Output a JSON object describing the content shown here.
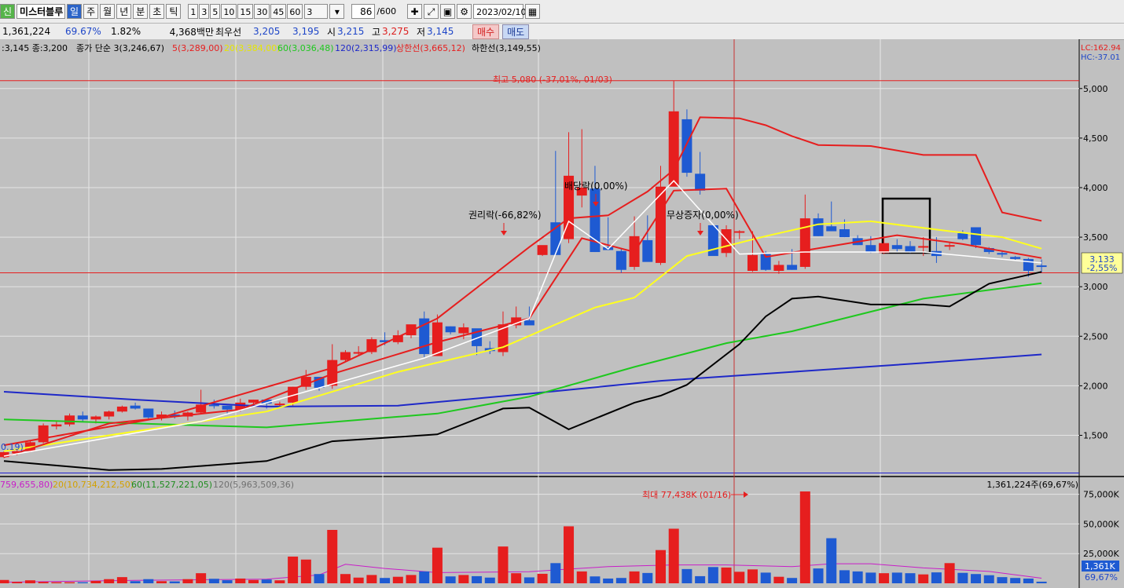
{
  "toolbar": {
    "badge": "신",
    "stock_name": "미스터블루",
    "periods": [
      {
        "label": "일",
        "selected": true
      },
      {
        "label": "주",
        "selected": false
      },
      {
        "label": "월",
        "selected": false
      },
      {
        "label": "년",
        "selected": false
      },
      {
        "label": "분",
        "selected": false
      },
      {
        "label": "초",
        "selected": false
      },
      {
        "label": "틱",
        "selected": false
      }
    ],
    "intervals": [
      "1",
      "3",
      "5",
      "10",
      "15",
      "30",
      "45",
      "60"
    ],
    "interval_select": "3",
    "count_value": "86",
    "count_total": "/600",
    "date": "2023/02/10",
    "icons": [
      "crosshair-icon",
      "trend-icon",
      "save-icon",
      "gear-icon"
    ]
  },
  "info": {
    "volume": "1,361,224",
    "vol_ratio": "69.67%",
    "turnover": "1.82%",
    "amount": "4,368백만",
    "best_ask_label": "최우선",
    "best_ask": "3,205",
    "best_bid": "3,195",
    "open_label": "시",
    "open": "3,215",
    "high_label": "고",
    "high": "3,275",
    "low_label": "저",
    "low": "3,145",
    "buy": "매수",
    "sell": "매도"
  },
  "price_header": [
    {
      "text": ":3,145 종:3,200",
      "color": "#000000"
    },
    {
      "text": "종가 단순 3(3,246,67)",
      "color": "#000000"
    },
    {
      "text": "5(3,289,00)",
      "color": "#e61e1e"
    },
    {
      "text": "20(3,384,00)",
      "color": "#e6e600"
    },
    {
      "text": "60(3,036,48)",
      "color": "#1ec81e"
    },
    {
      "text": "120(2,315,99)",
      "color": "#1e28c8"
    },
    {
      "text": "상한선(3,665,12)",
      "color": "#e61e1e"
    },
    {
      "text": "하한선(3,149,55)",
      "color": "#000000"
    }
  ],
  "volume_header": [
    {
      "text": "759,655,80)",
      "color": "#c81ec8"
    },
    {
      "text": "20(10,734,212,50)",
      "color": "#d2a000"
    },
    {
      "text": "60(11,527,221,05)",
      "color": "#1e8c1e"
    },
    {
      "text": "120(5,963,509,36)",
      "color": "#707070"
    }
  ],
  "volume_right_label": "1,361,224주(69,67%)",
  "lc_label": "LC:162.94",
  "hc_label": "HC:-37.01",
  "left_edge_label": "0.19)",
  "annotations": {
    "max_price": "최고 5,080 (-37,01%, 01/03)",
    "rights": "권리락(-66,82%)",
    "dividend": "배당락(0,00%)",
    "bonus": "무상증자(0,00%)",
    "max_volume": "최대 77,438K (01/16)"
  },
  "current_price": "3,133",
  "current_change": "-2,55%",
  "current_vol": "1,361K",
  "current_vol_ratio": "69,67%",
  "chart_data": {
    "type": "candlestick",
    "price_axis": {
      "ticks": [
        "5,000",
        "4,500",
        "4,000",
        "3,500",
        "3,000",
        "2,500",
        "2,000",
        "1,500"
      ],
      "ylim": [
        1100,
        5450
      ]
    },
    "volume_axis": {
      "ticks": [
        "75,000K",
        "50,000K",
        "25,000K"
      ],
      "ylim_k": [
        0,
        88000
      ]
    },
    "candles": [
      [
        1280,
        1340,
        1270,
        1330,
        2800
      ],
      [
        1320,
        1360,
        1300,
        1340,
        1200
      ],
      [
        1340,
        1450,
        1330,
        1430,
        2500
      ],
      [
        1430,
        1620,
        1420,
        1600,
        1200
      ],
      [
        1590,
        1650,
        1560,
        1610,
        900
      ],
      [
        1610,
        1720,
        1590,
        1700,
        900
      ],
      [
        1700,
        1740,
        1640,
        1660,
        900
      ],
      [
        1660,
        1700,
        1620,
        1690,
        2000
      ],
      [
        1690,
        1750,
        1660,
        1740,
        3500
      ],
      [
        1740,
        1800,
        1730,
        1790,
        5200
      ],
      [
        1800,
        1830,
        1760,
        1770,
        1800
      ],
      [
        1770,
        1760,
        1660,
        1680,
        3500
      ],
      [
        1680,
        1740,
        1650,
        1710,
        1800
      ],
      [
        1710,
        1750,
        1670,
        1690,
        1600
      ],
      [
        1690,
        1740,
        1650,
        1730,
        3500
      ],
      [
        1730,
        1960,
        1720,
        1810,
        8500
      ],
      [
        1810,
        1860,
        1770,
        1800,
        3800
      ],
      [
        1800,
        1800,
        1720,
        1760,
        2600
      ],
      [
        1760,
        1870,
        1740,
        1830,
        4000
      ],
      [
        1830,
        1860,
        1800,
        1860,
        2800
      ],
      [
        1860,
        1850,
        1770,
        1820,
        3200
      ],
      [
        1820,
        1840,
        1780,
        1820,
        2500
      ],
      [
        1830,
        1990,
        1800,
        1990,
        22500
      ],
      [
        1990,
        2160,
        1960,
        2090,
        20000
      ],
      [
        2090,
        2050,
        1950,
        1980,
        7800
      ],
      [
        2000,
        2420,
        1970,
        2260,
        45000
      ],
      [
        2260,
        2360,
        2240,
        2340,
        7800
      ],
      [
        2340,
        2400,
        2300,
        2340,
        4800
      ],
      [
        2340,
        2490,
        2320,
        2470,
        7000
      ],
      [
        2460,
        2540,
        2410,
        2440,
        4500
      ],
      [
        2440,
        2560,
        2420,
        2510,
        5500
      ],
      [
        2510,
        2610,
        2480,
        2620,
        7000
      ],
      [
        2680,
        2750,
        2290,
        2320,
        10000
      ],
      [
        2300,
        2720,
        2300,
        2640,
        30000
      ],
      [
        2600,
        2600,
        2520,
        2540,
        5800
      ],
      [
        2530,
        2630,
        2470,
        2590,
        7000
      ],
      [
        2580,
        2480,
        2310,
        2400,
        6000
      ],
      [
        2380,
        2450,
        2320,
        2350,
        4800
      ],
      [
        2340,
        2750,
        2300,
        2620,
        31000
      ],
      [
        2610,
        2800,
        2580,
        2690,
        8500
      ],
      [
        2660,
        2800,
        2620,
        2610,
        5000
      ],
      [
        3320,
        3400,
        3310,
        3420,
        8000
      ],
      [
        3650,
        4370,
        3320,
        3320,
        17000
      ],
      [
        3480,
        4560,
        3440,
        4120,
        48000
      ],
      [
        3920,
        4590,
        3800,
        4000,
        10000
      ],
      [
        3990,
        4220,
        3350,
        3350,
        5800
      ],
      [
        3400,
        3700,
        3400,
        3370,
        4000
      ],
      [
        3360,
        3380,
        3140,
        3170,
        4500
      ],
      [
        3200,
        3710,
        3170,
        3510,
        10000
      ],
      [
        3470,
        3720,
        3450,
        3250,
        8700
      ],
      [
        3240,
        4220,
        3220,
        4010,
        28000
      ],
      [
        4010,
        5080,
        4090,
        4770,
        46000
      ],
      [
        4690,
        4790,
        4110,
        4150,
        12000
      ],
      [
        4140,
        4360,
        3930,
        3970,
        6000
      ],
      [
        3620,
        3620,
        3340,
        3310,
        13700
      ],
      [
        3340,
        3620,
        3300,
        3580,
        13300
      ],
      [
        3560,
        3570,
        3480,
        3560,
        9700
      ],
      [
        3160,
        3560,
        3150,
        3320,
        11700
      ],
      [
        3330,
        3360,
        3160,
        3170,
        9000
      ],
      [
        3160,
        3260,
        3130,
        3220,
        5500
      ],
      [
        3220,
        3380,
        3170,
        3170,
        4500
      ],
      [
        3200,
        3930,
        3180,
        3690,
        77400
      ],
      [
        3690,
        3740,
        3510,
        3510,
        12500
      ],
      [
        3610,
        3860,
        3560,
        3560,
        38000
      ],
      [
        3580,
        3680,
        3500,
        3500,
        11000
      ],
      [
        3490,
        3520,
        3420,
        3420,
        10000
      ],
      [
        3420,
        3510,
        3340,
        3350,
        9000
      ],
      [
        3340,
        3510,
        3330,
        3440,
        8500
      ],
      [
        3420,
        3480,
        3350,
        3380,
        9000
      ],
      [
        3410,
        3460,
        3340,
        3350,
        8500
      ],
      [
        3410,
        3500,
        3310,
        3410,
        7500
      ],
      [
        3360,
        3500,
        3240,
        3310,
        9200
      ],
      [
        3410,
        3450,
        3370,
        3420,
        17000
      ],
      [
        3540,
        3570,
        3470,
        3480,
        8800
      ],
      [
        3600,
        3570,
        3390,
        3420,
        7800
      ],
      [
        3390,
        3400,
        3330,
        3350,
        6800
      ],
      [
        3340,
        3360,
        3300,
        3330,
        5200
      ],
      [
        3300,
        3310,
        3260,
        3280,
        4500
      ],
      [
        3280,
        3290,
        3100,
        3160,
        4000
      ],
      [
        3215,
        3275,
        3145,
        3200,
        1361
      ]
    ],
    "ma3": [
      [
        0,
        1290
      ],
      [
        15,
        1640
      ],
      [
        32,
        2280
      ],
      [
        40,
        2680
      ],
      [
        43,
        3660
      ],
      [
        46,
        3380
      ],
      [
        51,
        4070
      ],
      [
        56,
        3330
      ],
      [
        61,
        3350
      ],
      [
        70,
        3350
      ],
      [
        79,
        3240
      ]
    ],
    "ma5": [
      [
        0,
        1280
      ],
      [
        8,
        1620
      ],
      [
        18,
        1760
      ],
      [
        25,
        2120
      ],
      [
        33,
        2440
      ],
      [
        40,
        2680
      ],
      [
        44,
        3490
      ],
      [
        48,
        3350
      ],
      [
        51,
        3970
      ],
      [
        55,
        3990
      ],
      [
        58,
        3300
      ],
      [
        63,
        3410
      ],
      [
        68,
        3520
      ],
      [
        73,
        3430
      ],
      [
        79,
        3289
      ]
    ],
    "ma20": [
      [
        0,
        1340
      ],
      [
        10,
        1540
      ],
      [
        20,
        1740
      ],
      [
        30,
        2140
      ],
      [
        38,
        2390
      ],
      [
        45,
        2790
      ],
      [
        48,
        2890
      ],
      [
        52,
        3310
      ],
      [
        58,
        3510
      ],
      [
        62,
        3630
      ],
      [
        66,
        3660
      ],
      [
        72,
        3560
      ],
      [
        76,
        3500
      ],
      [
        79,
        3384
      ]
    ],
    "ma60": [
      [
        0,
        1660
      ],
      [
        10,
        1620
      ],
      [
        20,
        1580
      ],
      [
        33,
        1720
      ],
      [
        40,
        1890
      ],
      [
        48,
        2190
      ],
      [
        55,
        2430
      ],
      [
        60,
        2550
      ],
      [
        70,
        2880
      ],
      [
        79,
        3036
      ]
    ],
    "ma120": [
      [
        0,
        1940
      ],
      [
        10,
        1860
      ],
      [
        20,
        1790
      ],
      [
        30,
        1800
      ],
      [
        40,
        1920
      ],
      [
        50,
        2050
      ],
      [
        60,
        2140
      ],
      [
        70,
        2230
      ],
      [
        79,
        2316
      ]
    ],
    "bb_upper": [
      [
        0,
        1400
      ],
      [
        12,
        1680
      ],
      [
        25,
        2180
      ],
      [
        33,
        2680
      ],
      [
        40,
        3400
      ],
      [
        43,
        3690
      ],
      [
        46,
        3720
      ],
      [
        49,
        3960
      ],
      [
        51,
        4180
      ],
      [
        53,
        4710
      ],
      [
        56,
        4700
      ],
      [
        58,
        4630
      ],
      [
        60,
        4520
      ],
      [
        62,
        4430
      ],
      [
        66,
        4420
      ],
      [
        70,
        4330
      ],
      [
        74,
        4330
      ],
      [
        76,
        3750
      ],
      [
        79,
        3665
      ]
    ],
    "bb_lower": [
      [
        0,
        1240
      ],
      [
        8,
        1150
      ],
      [
        12,
        1160
      ],
      [
        20,
        1240
      ],
      [
        25,
        1440
      ],
      [
        33,
        1510
      ],
      [
        38,
        1770
      ],
      [
        40,
        1780
      ],
      [
        43,
        1560
      ],
      [
        48,
        1830
      ],
      [
        50,
        1900
      ],
      [
        52,
        2010
      ],
      [
        56,
        2420
      ],
      [
        58,
        2700
      ],
      [
        60,
        2880
      ],
      [
        62,
        2900
      ],
      [
        66,
        2820
      ],
      [
        70,
        2820
      ],
      [
        72,
        2800
      ],
      [
        75,
        3030
      ],
      [
        79,
        3150
      ]
    ],
    "h_lines": {
      "max_price": 5080,
      "ref_price": 3140,
      "base_price": 1120
    },
    "volume_ma": [
      [
        0,
        900
      ],
      [
        10,
        2500
      ],
      [
        20,
        3500
      ],
      [
        24,
        7000
      ],
      [
        26,
        16000
      ],
      [
        29,
        12500
      ],
      [
        33,
        9000
      ],
      [
        40,
        9800
      ],
      [
        43,
        12000
      ],
      [
        46,
        14000
      ],
      [
        51,
        15500
      ],
      [
        55,
        15500
      ],
      [
        60,
        14000
      ],
      [
        63,
        16500
      ],
      [
        66,
        16500
      ],
      [
        70,
        13000
      ],
      [
        75,
        10000
      ],
      [
        79,
        4300
      ]
    ]
  }
}
